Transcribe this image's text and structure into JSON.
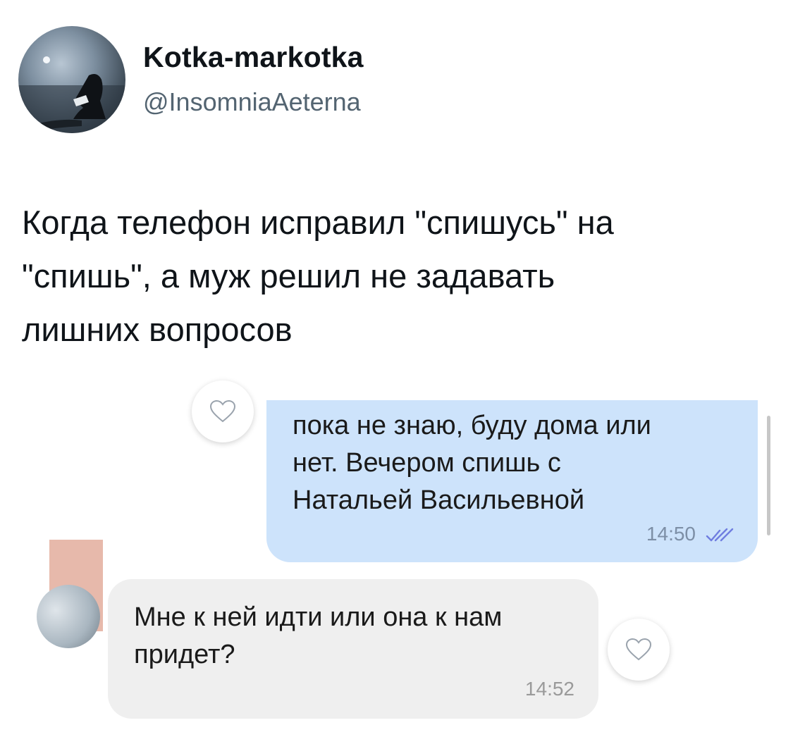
{
  "tweet": {
    "display_name": "Kotka-markotka",
    "handle": "@InsomniaAeterna",
    "text": "Когда телефон исправил \"спишусь\" на\n\"спишь\", а муж решил не задавать\nлишних вопросов",
    "avatar_icon": "profile-photo"
  },
  "chat": {
    "outgoing": {
      "text": "пока не знаю, буду дома или\nнет. Вечером спишь с\nНатальей Васильевной",
      "time": "14:50",
      "status_icon": "double-check-icon",
      "bubble_color": "#cde3fb"
    },
    "incoming": {
      "text": "Мне к ней идти или она к нам\nпридет?",
      "time": "14:52",
      "bubble_color": "#efefef"
    },
    "reaction_icon": "heart-outline-icon"
  }
}
